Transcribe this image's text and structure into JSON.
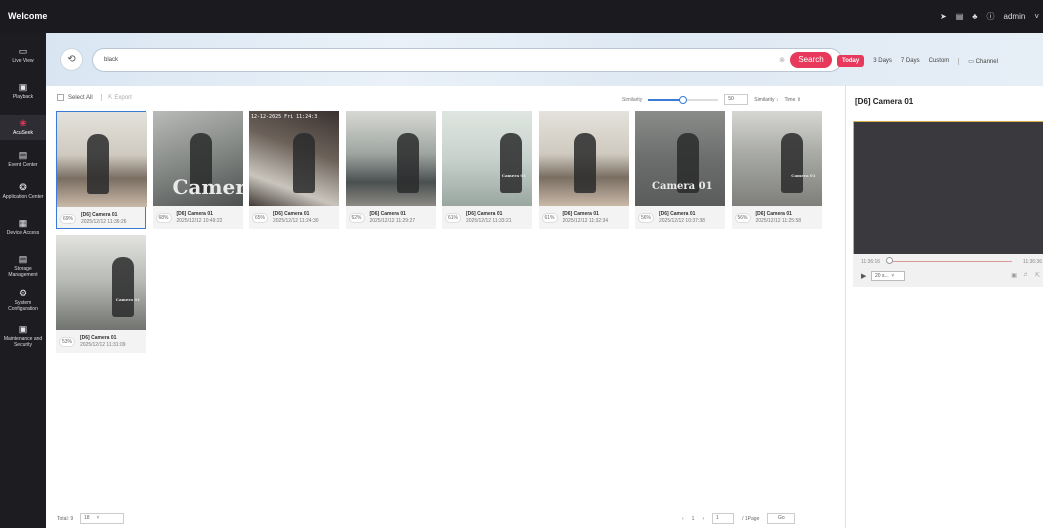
{
  "app": {
    "title": "Welcome",
    "user": "admin"
  },
  "topbar_icons": [
    "send-icon",
    "calendar-icon",
    "bell-icon",
    "info-icon"
  ],
  "nav": {
    "items": [
      {
        "label": "Live View",
        "icon": "monitor-icon",
        "glyph": "▭"
      },
      {
        "label": "Playback",
        "icon": "playback-icon",
        "glyph": "▣"
      },
      {
        "label": "AcuSeek",
        "icon": "acuseek-icon",
        "glyph": "❀",
        "active": true
      },
      {
        "label": "Event Center",
        "icon": "event-icon",
        "glyph": "▤"
      },
      {
        "label": "Application Center",
        "icon": "app-icon",
        "glyph": "❂"
      },
      {
        "label": "Device Access",
        "icon": "device-icon",
        "glyph": "▦"
      },
      {
        "label": "Storage Management",
        "icon": "storage-icon",
        "glyph": "▤"
      },
      {
        "label": "System Configuration",
        "icon": "gear-icon",
        "glyph": "⚙"
      },
      {
        "label": "Maintenance and Security",
        "icon": "shield-icon",
        "glyph": "▣"
      }
    ]
  },
  "search": {
    "query": "black",
    "button": "Search",
    "quick_ranges": [
      "Today",
      "3 Days",
      "7 Days",
      "Custom"
    ],
    "channel": "Channel"
  },
  "toolbar": {
    "select_all": "Select All",
    "export": "Export",
    "similarity_label": "Similarity",
    "similarity_value": "50",
    "similarity_fraction": 0.5,
    "sort_similarity": "Similarity",
    "sort_time": "Time"
  },
  "results": [
    {
      "score": "69%",
      "camera": "[D6] Camera 01",
      "datetime": "2025/12/12 11:36:26",
      "selected": true
    },
    {
      "score": "68%",
      "camera": "[D6] Camera 01",
      "datetime": "2025/12/12 10:49:22"
    },
    {
      "score": "65%",
      "camera": "[D6] Camera 01",
      "datetime": "2025/12/12 11:24:30"
    },
    {
      "score": "62%",
      "camera": "[D6] Camera 01",
      "datetime": "2025/12/12 11:29:27"
    },
    {
      "score": "61%",
      "camera": "[D6] Camera 01",
      "datetime": "2025/12/12 11:33:21"
    },
    {
      "score": "61%",
      "camera": "[D6] Camera 01",
      "datetime": "2025/12/12 11:32:34"
    },
    {
      "score": "56%",
      "camera": "[D6] Camera 01",
      "datetime": "2025/12/12 10:37:38"
    },
    {
      "score": "56%",
      "camera": "[D6] Camera 01",
      "datetime": "2025/12/12 11:25:58"
    },
    {
      "score": "53%",
      "camera": "[D6] Camera 01",
      "datetime": "2025/12/12 11:31:09"
    }
  ],
  "thumb_overlays": {
    "cam_text_large": "Camer",
    "cam_text_mid": "Camera 01",
    "timestamp": "12-12-2025 Fri 11:24:3"
  },
  "footer": {
    "total": "Total: 9",
    "per_page": "18",
    "current_page": "1",
    "page_input": "1",
    "pages_suffix": "/ 1Page",
    "go": "Go"
  },
  "preview": {
    "title": "[D6] Camera 01",
    "time_start": "11:36:16",
    "time_end": "11:36:36",
    "speed": "20 s..."
  }
}
